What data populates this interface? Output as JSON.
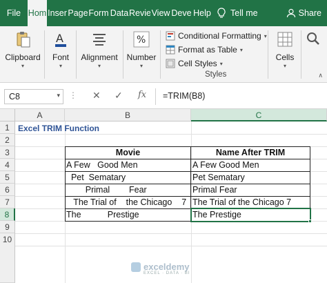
{
  "ribbon_tabs": {
    "file": "File",
    "home": "Hom",
    "insert": "Inser",
    "page": "Page",
    "formulas": "Form",
    "data": "Data",
    "review": "Revie",
    "view": "View",
    "developer": "Deve",
    "help": "Help",
    "tell_me": "Tell me",
    "share": "Share"
  },
  "ribbon": {
    "clipboard": "Clipboard",
    "font": "Font",
    "alignment": "Alignment",
    "number": "Number",
    "conditional_formatting": "Conditional Formatting",
    "format_as_table": "Format as Table",
    "cell_styles": "Cell Styles",
    "styles_group": "Styles",
    "cells": "Cells"
  },
  "formula_bar": {
    "name_box": "C8",
    "formula": "=TRIM(B8)",
    "fx": "fx"
  },
  "columns": [
    "A",
    "B",
    "C"
  ],
  "rows": [
    "1",
    "2",
    "3",
    "4",
    "5",
    "6",
    "7",
    "8",
    "9",
    "10"
  ],
  "sheet": {
    "title": "Excel TRIM Function",
    "header_movie": "Movie",
    "header_trim": "Name After TRIM",
    "movies": [
      "A Few   Good Men",
      "  Pet  Sematary",
      "        Primal        Fear",
      "   The Trial of    the Chicago    7",
      "The           Prestige"
    ],
    "trimmed": [
      "A Few Good Men",
      "Pet Sematary",
      "Primal Fear",
      "The Trial of the Chicago 7",
      "The Prestige"
    ]
  },
  "watermark": {
    "name": "exceldemy",
    "tagline": "EXCEL · DATA · BI"
  },
  "colors": {
    "excel_green": "#217346",
    "title_blue": "#2f5496"
  }
}
